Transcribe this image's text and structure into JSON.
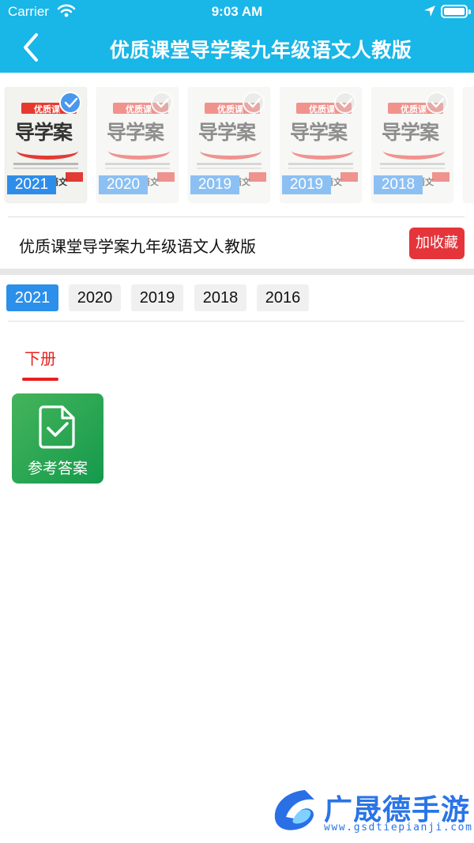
{
  "status_bar": {
    "carrier": "Carrier",
    "time": "9:03 AM"
  },
  "header": {
    "title": "优质课堂导学案九年级语文人教版"
  },
  "covers": [
    {
      "year": "2021",
      "brand": "优质课",
      "big": "导学案",
      "subject": "语文",
      "selected": true
    },
    {
      "year": "2020",
      "brand": "优质课",
      "big": "导学案",
      "subject": "语文",
      "selected": false
    },
    {
      "year": "2019",
      "brand": "优质课",
      "big": "导学案",
      "subject": "语文",
      "selected": false
    },
    {
      "year": "2019",
      "brand": "优质课",
      "big": "导学案",
      "subject": "语文",
      "selected": false
    },
    {
      "year": "2018",
      "brand": "优质课",
      "big": "导学案",
      "subject": "语文",
      "selected": false
    }
  ],
  "book": {
    "title": "优质课堂导学案九年级语文人教版",
    "favorite_label": "加收藏"
  },
  "years": [
    "2021",
    "2020",
    "2019",
    "2018",
    "2016"
  ],
  "active_year": "2021",
  "tabs": [
    {
      "label": "下册"
    }
  ],
  "answer": {
    "label": "参考答案"
  },
  "watermark": {
    "name": "广晟德手游",
    "url": "www.gsdtiepianji.com"
  },
  "colors": {
    "header": "#19b6e8",
    "chip_active": "#2c8fe9",
    "favorite": "#e5353a",
    "tab": "#e8201f",
    "answer_tile": "#23a552"
  }
}
